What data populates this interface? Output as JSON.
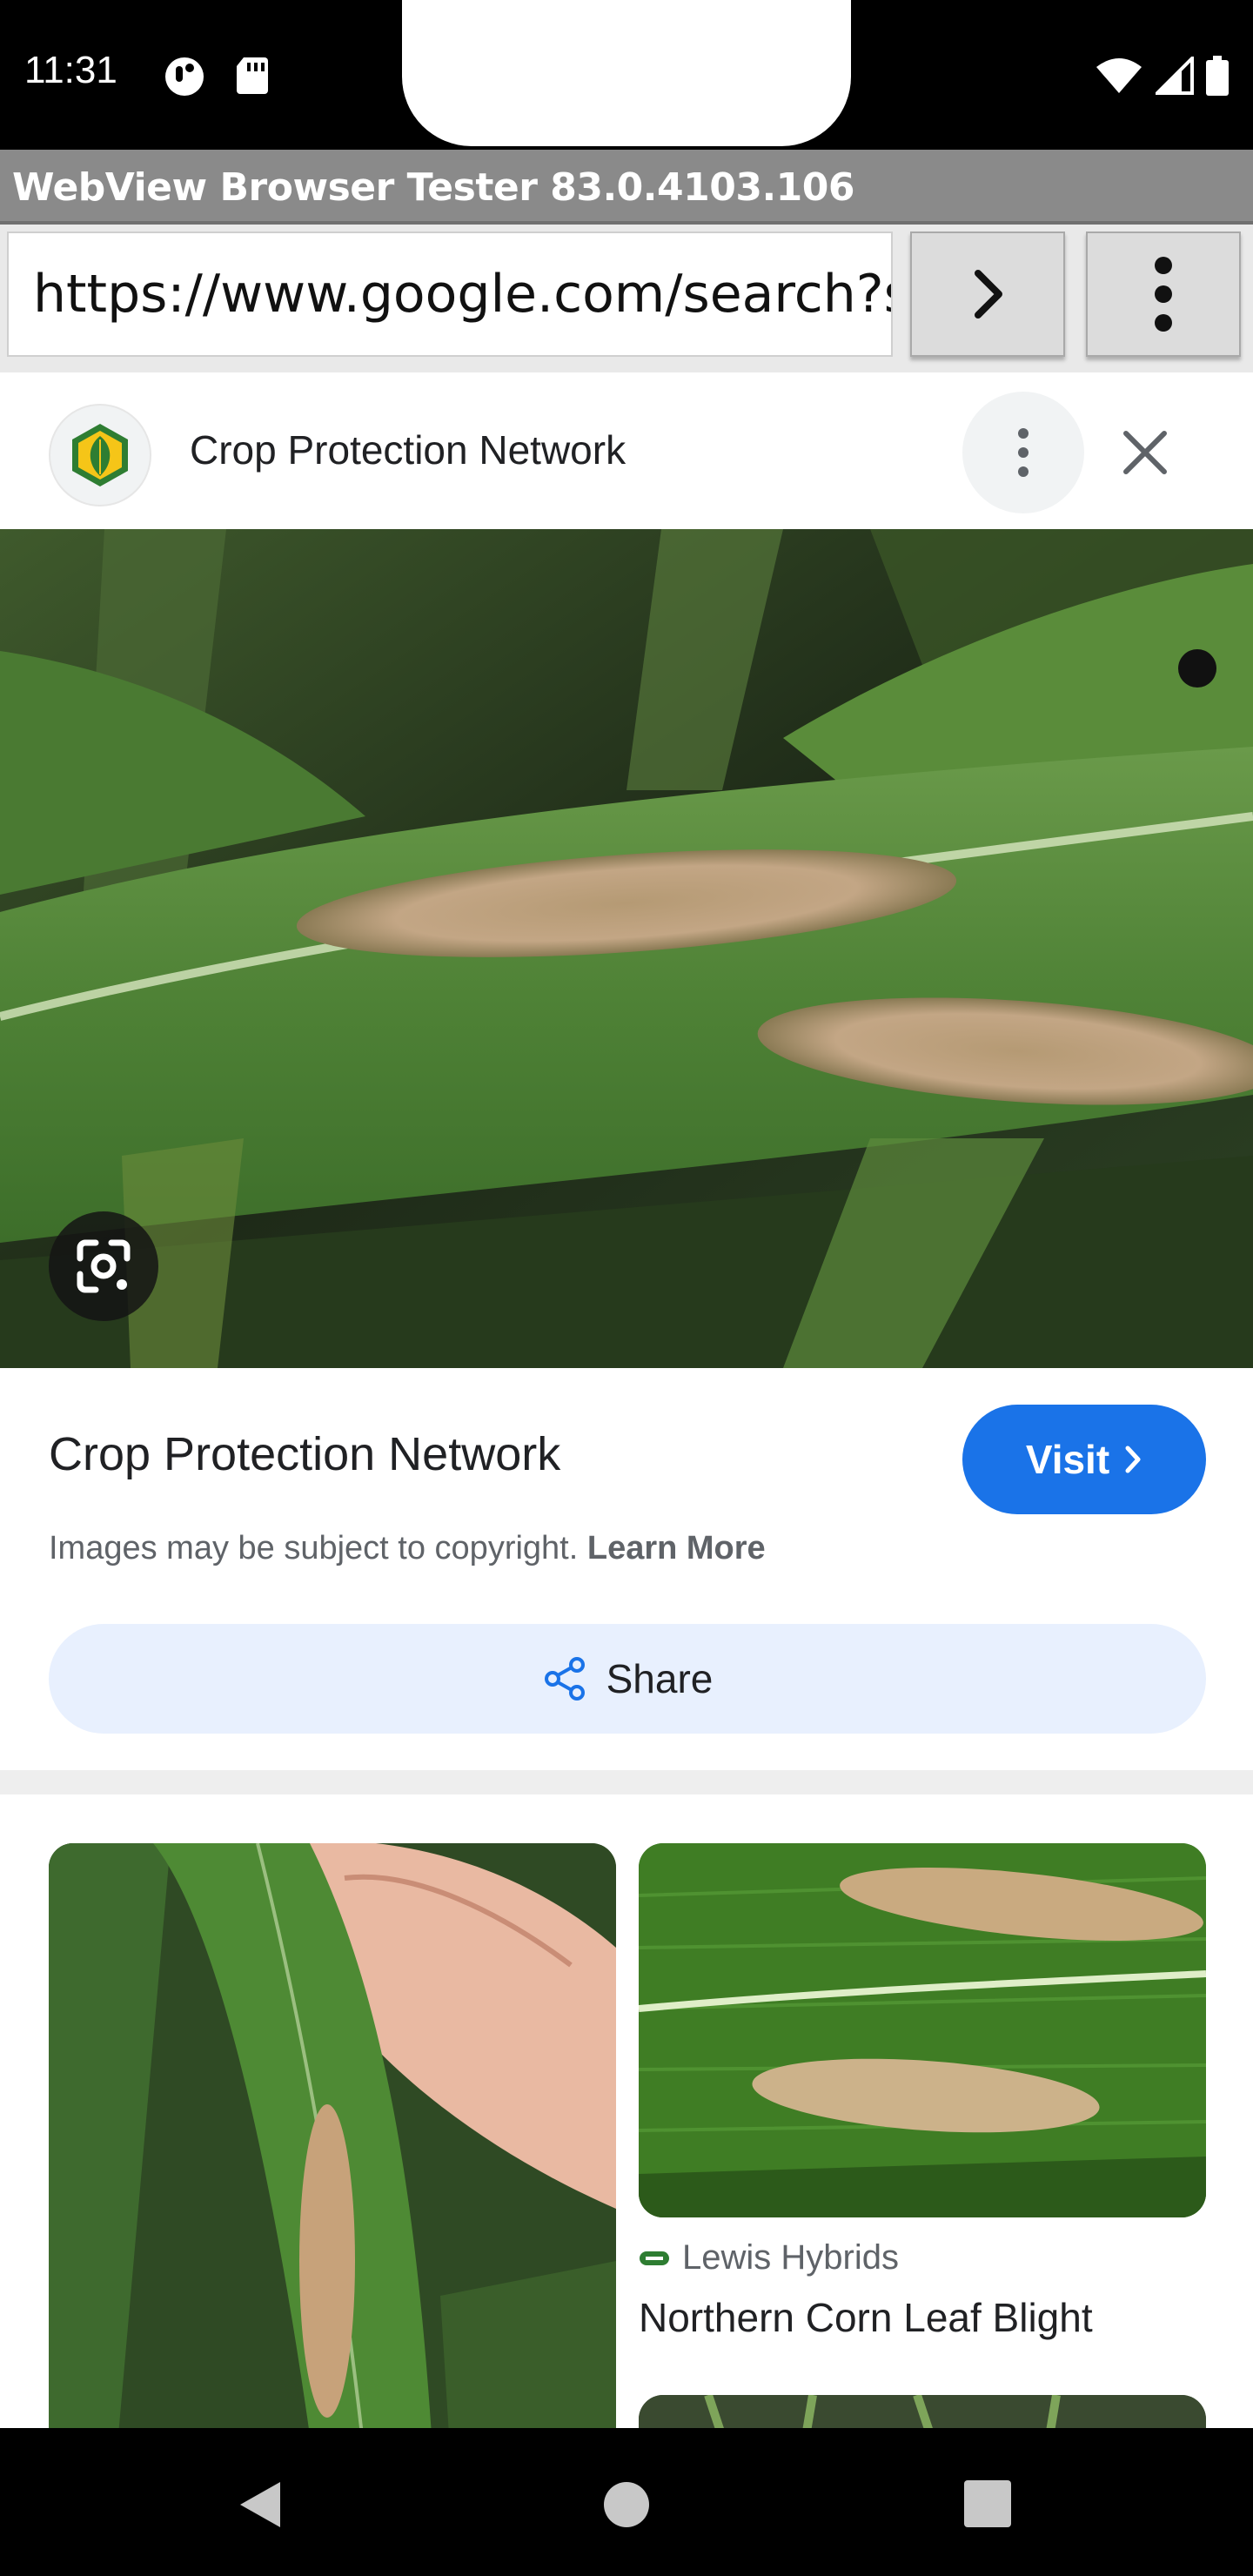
{
  "status_bar": {
    "time": "11:31",
    "icons": [
      "notification-dot-icon",
      "sd-card-icon",
      "wifi-icon",
      "signal-icon",
      "battery-icon"
    ]
  },
  "app": {
    "title": "WebView Browser Tester 83.0.4103.106"
  },
  "url_bar": {
    "value": "https://www.google.com/search?s",
    "go_icon": "chevron-right-icon",
    "menu_icon": "more-vert-icon"
  },
  "source_header": {
    "title": "Crop Protection Network"
  },
  "info": {
    "title": "Crop Protection Network",
    "visit_label": "Visit",
    "copyright_text": "Images may be subject to copyright.",
    "learn_more": "Learn More",
    "share_label": "Share"
  },
  "results": {
    "right_source": "Lewis Hybrids",
    "right_caption": "Northern Corn Leaf Blight"
  },
  "colors": {
    "accent": "#1a73e8",
    "share_bg": "#e8f0fe"
  }
}
